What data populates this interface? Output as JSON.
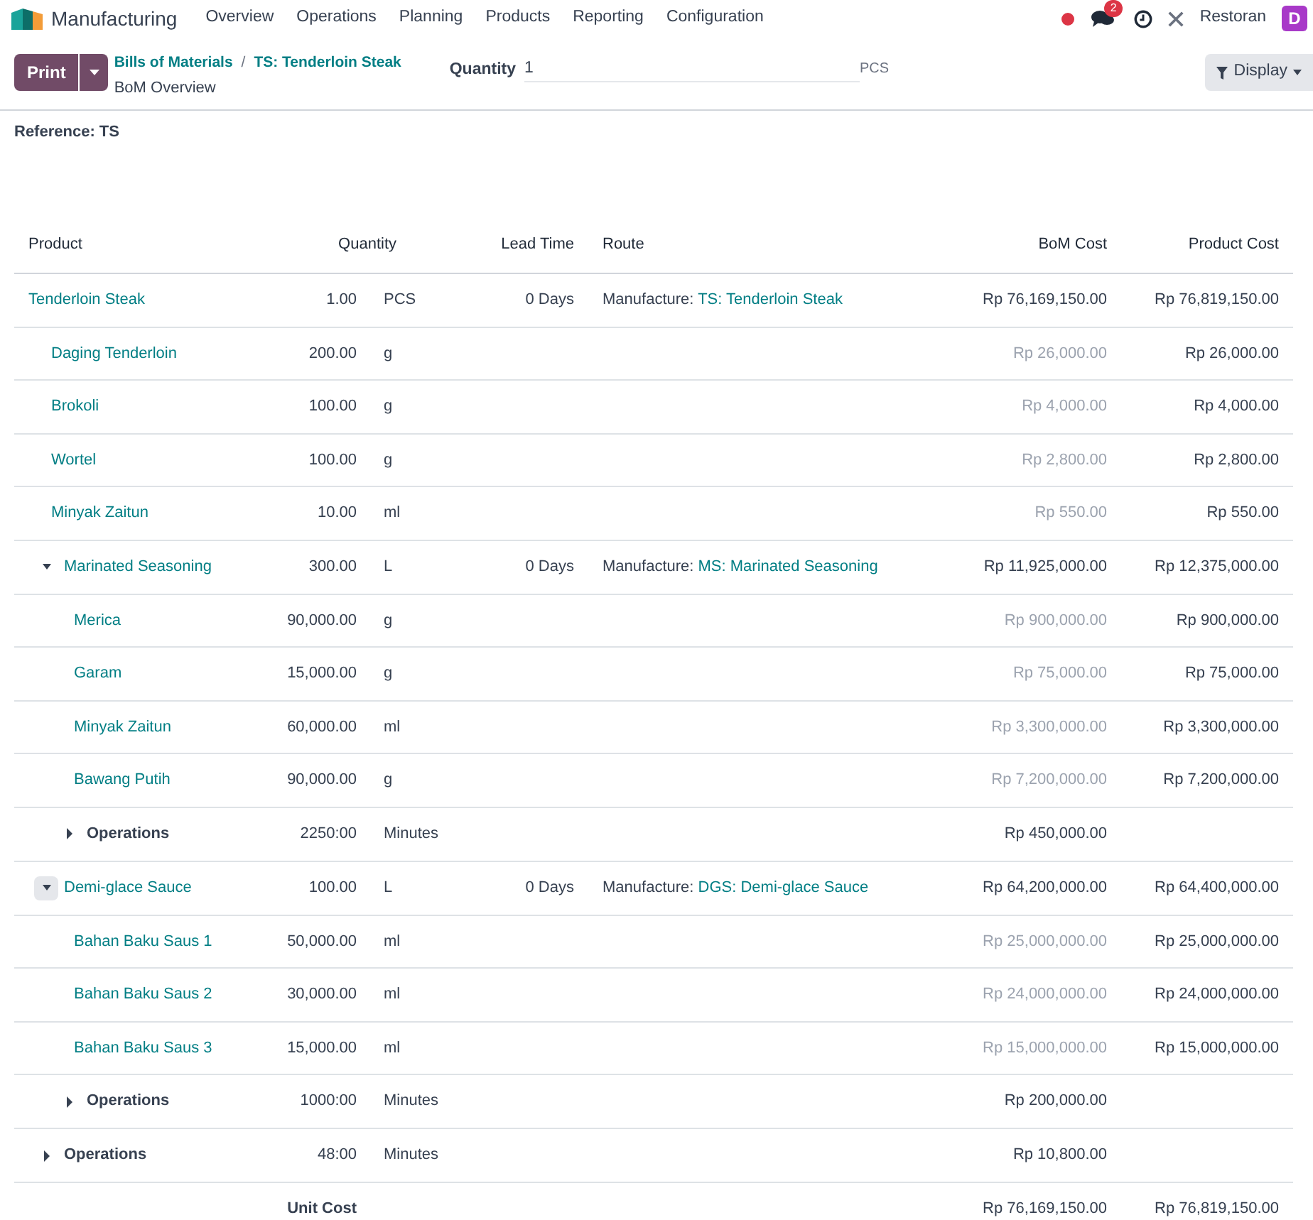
{
  "navbar": {
    "app_name": "Manufacturing",
    "menu": [
      "Overview",
      "Operations",
      "Planning",
      "Products",
      "Reporting",
      "Configuration"
    ],
    "chat_badge": "2",
    "company": "Restoran",
    "avatar": "D"
  },
  "control_panel": {
    "print_button": "Print",
    "breadcrumbs": [
      "Bills of Materials",
      "TS: Tenderloin Steak"
    ],
    "separator": "/",
    "page_title": "BoM Overview",
    "quantity_label": "Quantity",
    "quantity_value": "1",
    "quantity_uom": "PCS",
    "display_button": "Display"
  },
  "reference": "Reference: TS",
  "table": {
    "columns": [
      "Product",
      "Quantity",
      "Lead Time",
      "Route",
      "BoM Cost",
      "Product Cost"
    ],
    "rows": [
      {
        "kind": "product",
        "name": "Tenderloin Steak",
        "quantity": "1.00",
        "uom": "PCS",
        "lead_time": "0 Days",
        "route_label": "Manufacture:",
        "route_link": "TS: Tenderloin Steak",
        "bom_cost": "Rp 76,169,150.00",
        "product_cost": "Rp 76,819,150.00",
        "children": [
          {
            "kind": "component",
            "name": "Daging Tenderloin",
            "quantity": "200.00",
            "uom": "g",
            "bom_cost": "Rp 26,000.00",
            "product_cost": "Rp 26,000.00"
          },
          {
            "kind": "component",
            "name": "Brokoli",
            "quantity": "100.00",
            "uom": "g",
            "bom_cost": "Rp 4,000.00",
            "product_cost": "Rp 4,000.00"
          },
          {
            "kind": "component",
            "name": "Wortel",
            "quantity": "100.00",
            "uom": "g",
            "bom_cost": "Rp 2,800.00",
            "product_cost": "Rp 2,800.00"
          },
          {
            "kind": "component",
            "name": "Minyak Zaitun",
            "quantity": "10.00",
            "uom": "ml",
            "bom_cost": "Rp 550.00",
            "product_cost": "Rp 550.00"
          },
          {
            "kind": "subassembly",
            "name": "Marinated Seasoning",
            "expanded": true,
            "hovered": false,
            "quantity": "300.00",
            "uom": "L",
            "lead_time": "0 Days",
            "route_label": "Manufacture:",
            "route_link": "MS: Marinated Seasoning",
            "bom_cost": "Rp 11,925,000.00",
            "product_cost": "Rp 12,375,000.00",
            "children": [
              {
                "kind": "component",
                "name": "Merica",
                "quantity": "90,000.00",
                "uom": "g",
                "bom_cost": "Rp 900,000.00",
                "product_cost": "Rp 900,000.00"
              },
              {
                "kind": "component",
                "name": "Garam",
                "quantity": "15,000.00",
                "uom": "g",
                "bom_cost": "Rp 75,000.00",
                "product_cost": "Rp 75,000.00"
              },
              {
                "kind": "component",
                "name": "Minyak Zaitun",
                "quantity": "60,000.00",
                "uom": "ml",
                "bom_cost": "Rp 3,300,000.00",
                "product_cost": "Rp 3,300,000.00"
              },
              {
                "kind": "component",
                "name": "Bawang Putih",
                "quantity": "90,000.00",
                "uom": "g",
                "bom_cost": "Rp 7,200,000.00",
                "product_cost": "Rp 7,200,000.00"
              },
              {
                "kind": "operations",
                "name": "Operations",
                "expanded": false,
                "quantity": "2250:00",
                "uom": "Minutes",
                "bom_cost": "Rp 450,000.00"
              }
            ]
          },
          {
            "kind": "subassembly",
            "name": "Demi-glace Sauce",
            "expanded": true,
            "hovered": true,
            "quantity": "100.00",
            "uom": "L",
            "lead_time": "0 Days",
            "route_label": "Manufacture:",
            "route_link": "DGS: Demi-glace Sauce",
            "bom_cost": "Rp 64,200,000.00",
            "product_cost": "Rp 64,400,000.00",
            "children": [
              {
                "kind": "component",
                "name": "Bahan Baku Saus 1",
                "quantity": "50,000.00",
                "uom": "ml",
                "bom_cost": "Rp 25,000,000.00",
                "product_cost": "Rp 25,000,000.00"
              },
              {
                "kind": "component",
                "name": "Bahan Baku Saus 2",
                "quantity": "30,000.00",
                "uom": "ml",
                "bom_cost": "Rp 24,000,000.00",
                "product_cost": "Rp 24,000,000.00"
              },
              {
                "kind": "component",
                "name": "Bahan Baku Saus 3",
                "quantity": "15,000.00",
                "uom": "ml",
                "bom_cost": "Rp 15,000,000.00",
                "product_cost": "Rp 15,000,000.00"
              },
              {
                "kind": "operations",
                "name": "Operations",
                "expanded": false,
                "quantity": "1000:00",
                "uom": "Minutes",
                "bom_cost": "Rp 200,000.00"
              }
            ]
          },
          {
            "kind": "operations",
            "name": "Operations",
            "expanded": false,
            "quantity": "48:00",
            "uom": "Minutes",
            "bom_cost": "Rp 10,800.00"
          }
        ]
      }
    ],
    "footer": {
      "label": "Unit Cost",
      "bom_cost": "Rp 76,169,150.00",
      "product_cost": "Rp 76,819,150.00"
    }
  }
}
